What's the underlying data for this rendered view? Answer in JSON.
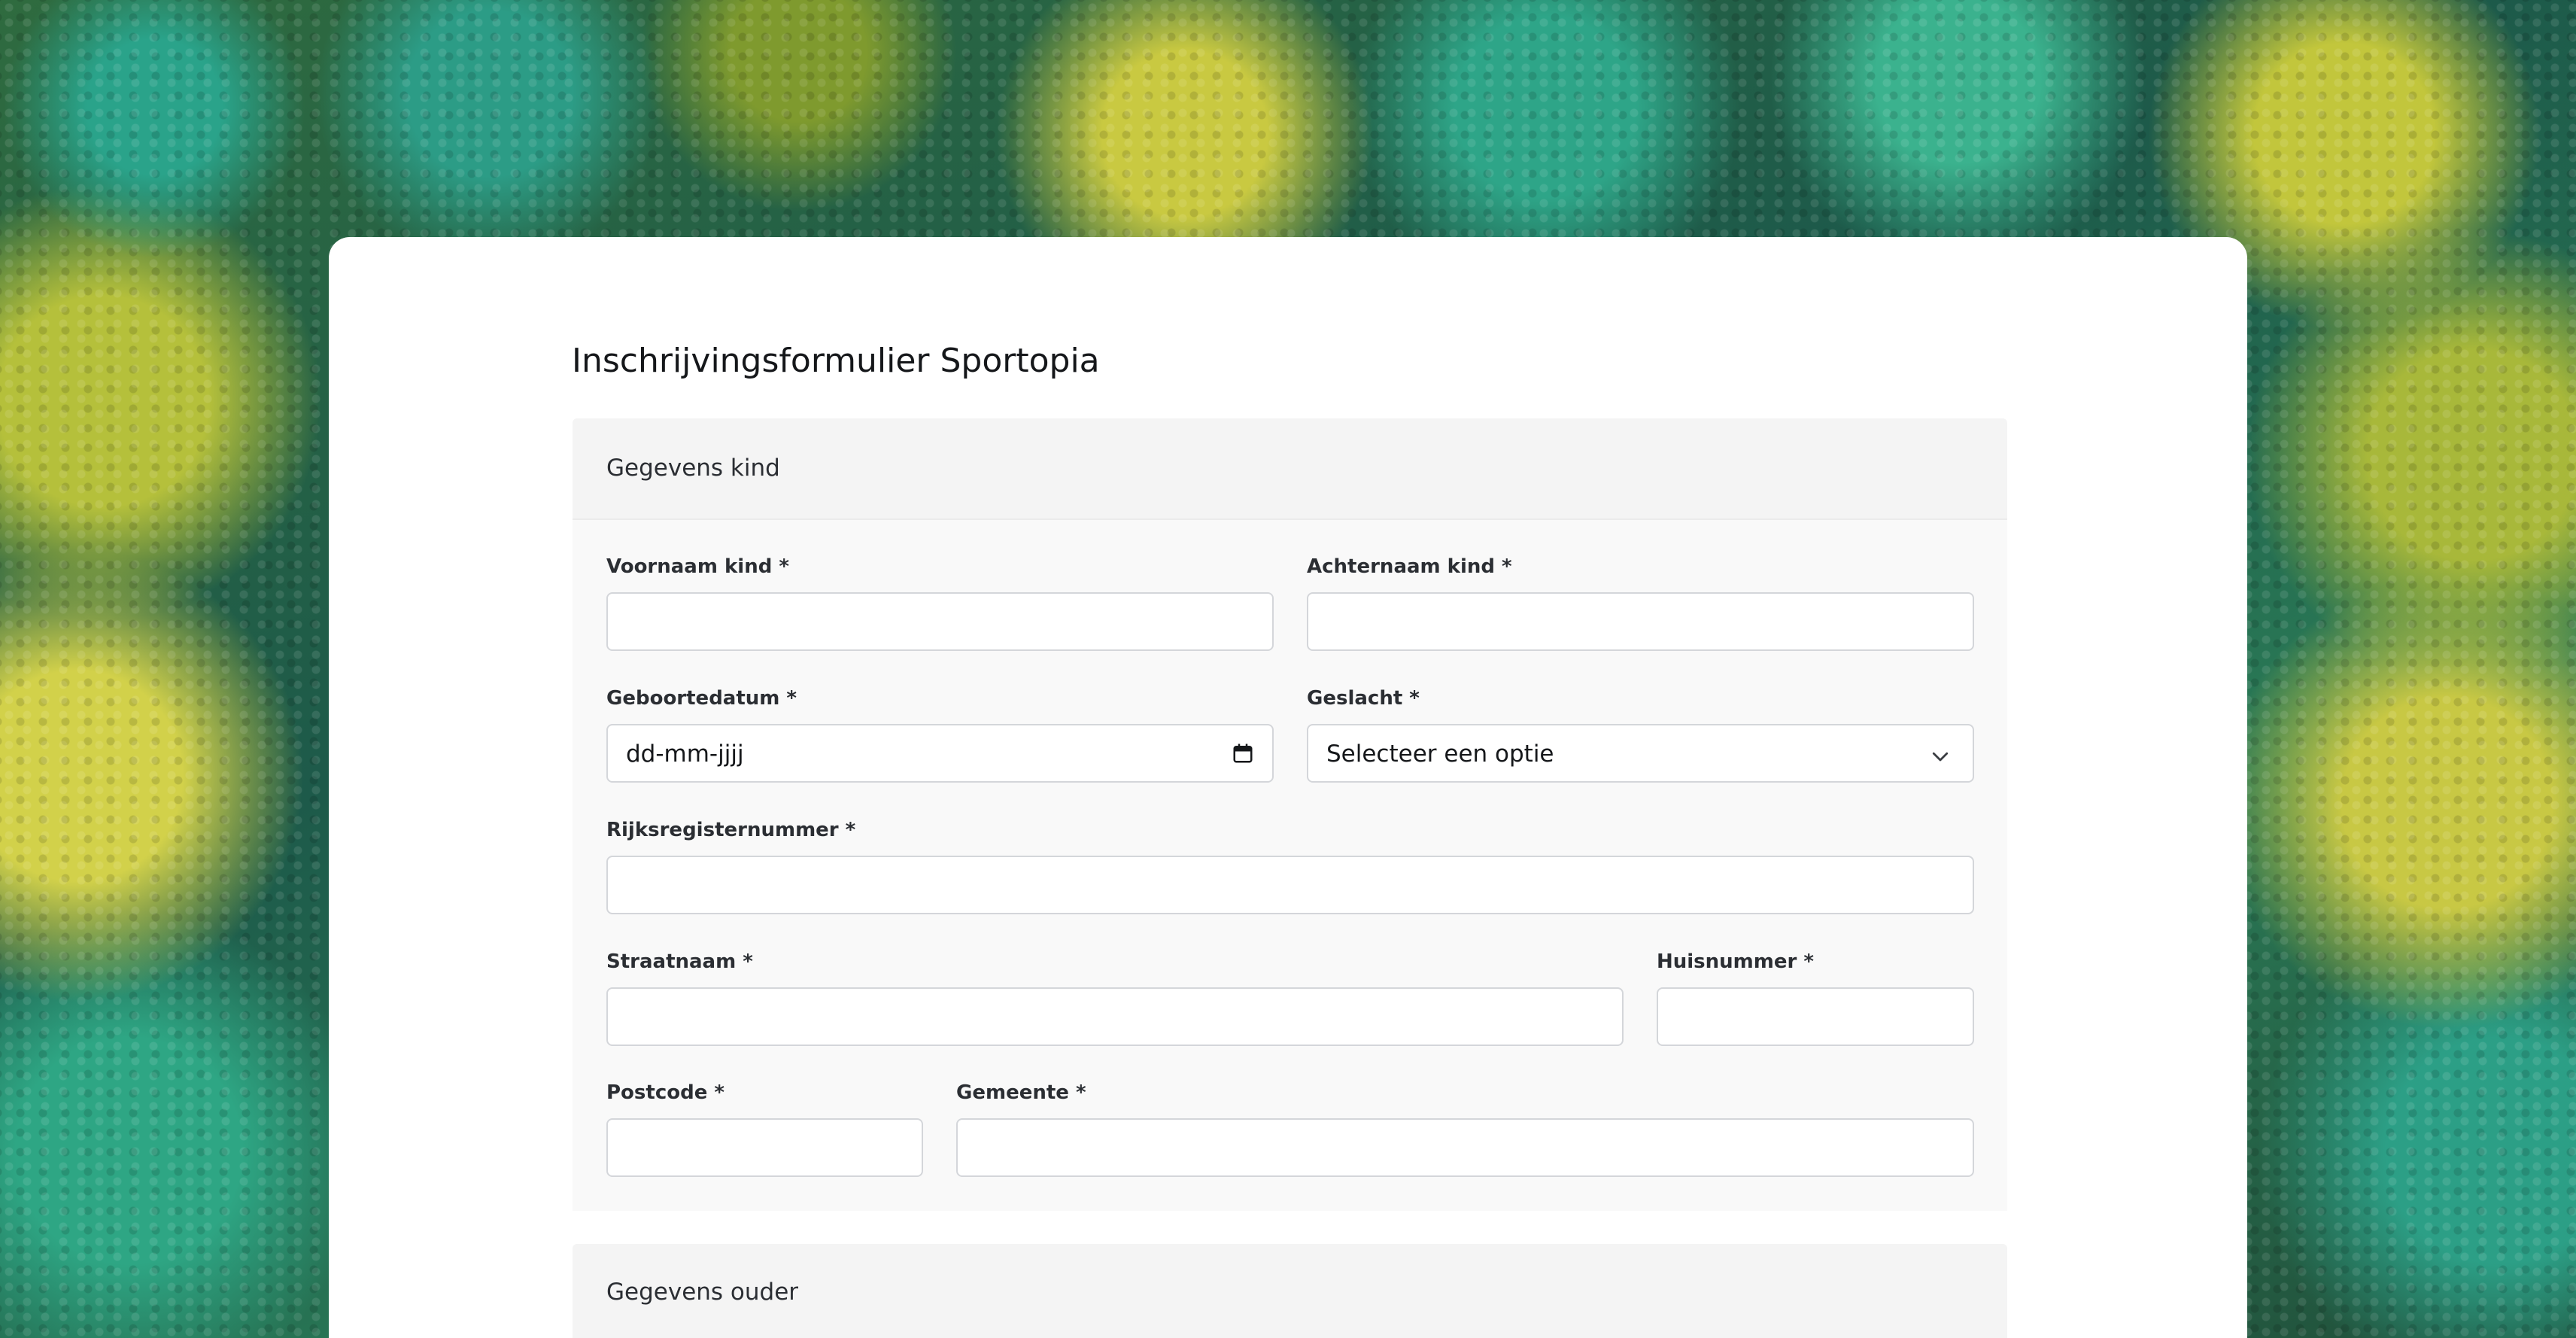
{
  "form": {
    "title": "Inschrijvingsformulier Sportopia"
  },
  "sections": [
    {
      "title": "Gegevens kind",
      "fields": {
        "first_name": {
          "label": "Voornaam kind *",
          "value": ""
        },
        "last_name": {
          "label": "Achternaam kind *",
          "value": ""
        },
        "birth_date": {
          "label": "Geboortedatum *",
          "placeholder": "dd-mm-jjjj"
        },
        "gender": {
          "label": "Geslacht *",
          "selected": "Selecteer een optie"
        },
        "national_number": {
          "label": "Rijksregisternummer *",
          "value": ""
        },
        "street": {
          "label": "Straatnaam *",
          "value": ""
        },
        "house_number": {
          "label": "Huisnummer *",
          "value": ""
        },
        "postal_code": {
          "label": "Postcode *",
          "value": ""
        },
        "municipality": {
          "label": "Gemeente *",
          "value": ""
        }
      }
    },
    {
      "title": "Gegevens ouder"
    }
  ],
  "icons": {
    "birth_date": "calendar-icon",
    "gender": "chevron-down-icon"
  }
}
